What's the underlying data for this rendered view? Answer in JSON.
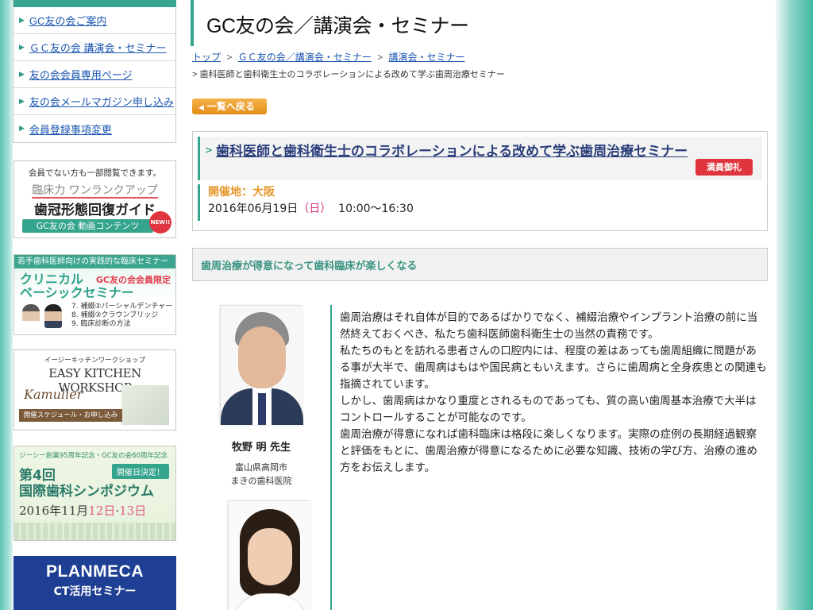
{
  "colors": {
    "accent": "#35a48c",
    "link": "#1a55b0",
    "title_link": "#2a3e7a",
    "venue": "#e5972a",
    "badge_red": "#e0343e",
    "back_button": "#f0a436"
  },
  "sidebar": {
    "nav": [
      {
        "label": "GC友の会ご案内",
        "icon": "triangle-right-icon"
      },
      {
        "label": "ＧＣ友の会 講演会・セミナー",
        "icon": "triangle-right-icon"
      },
      {
        "label": "友の会会員専用ページ",
        "icon": "triangle-right-icon"
      },
      {
        "label": "友の会メールマガジン申し込み",
        "icon": "triangle-right-icon"
      },
      {
        "label": "会員登録事項変更",
        "icon": "triangle-right-icon"
      }
    ],
    "banner_video": {
      "note": "会員でない方も一部閲覧できます。",
      "line1": "臨床力 ワンランクアップ",
      "line2": "歯冠形態回復ガイド",
      "bar": "GC友の会 動画コンテンツ",
      "new": "NEW!!"
    },
    "banner_clinical": {
      "head": "若手歯科医師向けの実践的な臨床セミナー",
      "title_line1": "クリニカル",
      "title_line2": "ベーシックセミナー",
      "member": "GC友の会会員限定",
      "items": [
        "7. 補綴②パーシャルデンチャー",
        "8. 補綴③クラウンブリッジ",
        "9. 臨床診断の方法"
      ]
    },
    "banner_kitchen": {
      "small": "イージーキッチンワークショップ",
      "title": "EASY KITCHEN WORKSHOP",
      "brand": "Kamulier",
      "bar": "開催スケジュール・お申し込み"
    },
    "banner_symposium": {
      "small": "ジーシー創業95周年記念・GC友の会60周年記念",
      "badge": "開催日決定！",
      "title1": "第4回",
      "title2": "国際歯科シンポジウム",
      "date_prefix": "2016年11月",
      "day1": "12日",
      "day2": "13日"
    },
    "banner_planmeca": {
      "title": "PLANMECA",
      "subtitle": "CT活用セミナー"
    }
  },
  "header": {
    "title": "GC友の会／講演会・セミナー"
  },
  "breadcrumb": {
    "items": [
      "トップ",
      "ＧＣ友の会／講演会・セミナー",
      "講演会・セミナー"
    ],
    "separator": ">",
    "current": "> 歯科医師と歯科衛生士のコラボレーションによる改めて学ぶ歯周治療セミナー"
  },
  "back_button": {
    "label": "一覧へ戻る",
    "icon": "chevron-left-icon"
  },
  "seminar": {
    "title_arrow": ">",
    "title": "歯科医師と歯科衛生士のコラボレーションによる改めて学ぶ歯周治療セミナー",
    "status_badge": "満員御礼",
    "venue": "開催地：大阪",
    "date": "2016年06月19日",
    "dow": "（日）",
    "time": "10:00〜16:30"
  },
  "tagline": "歯周治療が得意になって歯科臨床が楽しくなる",
  "speaker1": {
    "name": "牧野 明 先生",
    "city": "富山県高岡市",
    "clinic": "まきの歯科医院"
  },
  "description": [
    "歯周治療はそれ自体が目的であるばかりでなく、補綴治療やインプラント治療の前に当然終えておくべき、私たち歯科医師歯科衛生士の当然の責務です。",
    "私たちのもとを訪れる患者さんの口腔内には、程度の差はあっても歯周組織に問題がある事が大半で、歯周病はもはや国民病ともいえます。さらに歯周病と全身疾患との関連も指摘されています。",
    "しかし、歯周病はかなり重度とされるものであっても、質の高い歯周基本治療で大半はコントロールすることが可能なのです。",
    "歯周治療が得意になれば歯科臨床は格段に楽しくなります。実際の症例の長期経過観察と評価をもとに、歯周治療が得意になるために必要な知識、技術の学び方、治療の進め方をお伝えします。"
  ]
}
